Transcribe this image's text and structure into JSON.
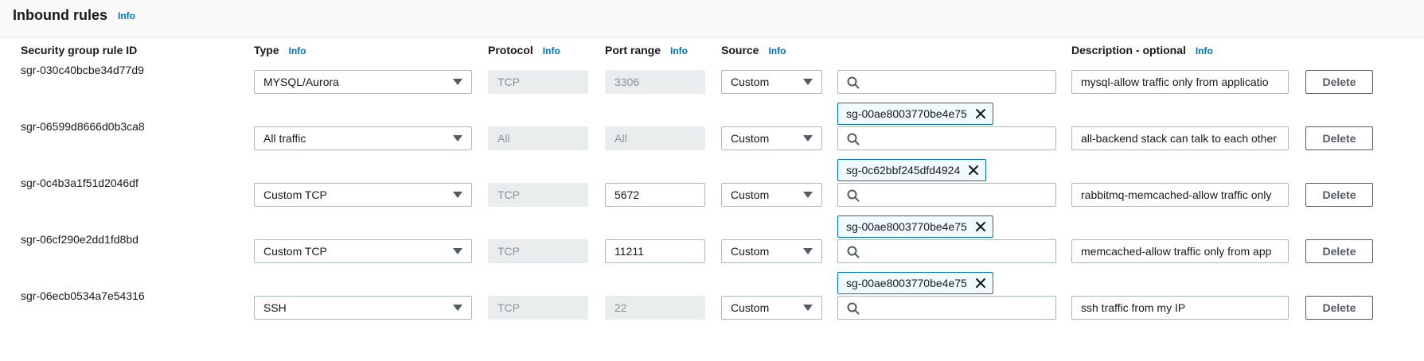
{
  "panel": {
    "title": "Inbound rules",
    "info_label": "Info"
  },
  "columns": {
    "rule_id": "Security group rule ID",
    "type": "Type",
    "protocol": "Protocol",
    "port_range": "Port range",
    "source": "Source",
    "description": "Description - optional",
    "info_label": "Info"
  },
  "delete_label": "Delete",
  "rules": [
    {
      "id": "sgr-030c40bcbe34d77d9",
      "type": "MYSQL/Aurora",
      "protocol": "TCP",
      "port": "3306",
      "port_editable": false,
      "source": "Custom",
      "search_value": "",
      "token": "sg-00ae8003770be4e75",
      "description": "mysql-allow traffic only from applicatio"
    },
    {
      "id": "sgr-06599d8666d0b3ca8",
      "type": "All traffic",
      "protocol": "All",
      "port": "All",
      "port_editable": false,
      "source": "Custom",
      "search_value": "",
      "token": "sg-0c62bbf245dfd4924",
      "description": "all-backend stack can talk to each other"
    },
    {
      "id": "sgr-0c4b3a1f51d2046df",
      "type": "Custom TCP",
      "protocol": "TCP",
      "port": "5672",
      "port_editable": true,
      "source": "Custom",
      "search_value": "",
      "token": "sg-00ae8003770be4e75",
      "description": "rabbitmq-memcached-allow traffic only"
    },
    {
      "id": "sgr-06cf290e2dd1fd8bd",
      "type": "Custom TCP",
      "protocol": "TCP",
      "port": "11211",
      "port_editable": true,
      "source": "Custom",
      "search_value": "",
      "token": "sg-00ae8003770be4e75",
      "description": "memcached-allow traffic only from app"
    },
    {
      "id": "sgr-06ecb0534a7e54316",
      "type": "SSH",
      "protocol": "TCP",
      "port": "22",
      "port_editable": false,
      "source": "Custom",
      "search_value": "",
      "token": "",
      "description": "ssh traffic from my IP"
    }
  ],
  "icons": {
    "search": "search-icon",
    "token_remove": "close-icon",
    "dropdown": "caret-down-icon"
  },
  "colors": {
    "link": "#0073bb",
    "text": "#16191f",
    "disabled_bg": "#eaeded",
    "disabled_text": "#879596",
    "border": "#aab7b8",
    "token_border": "#0073bb",
    "token_bg": "#f1faff"
  }
}
